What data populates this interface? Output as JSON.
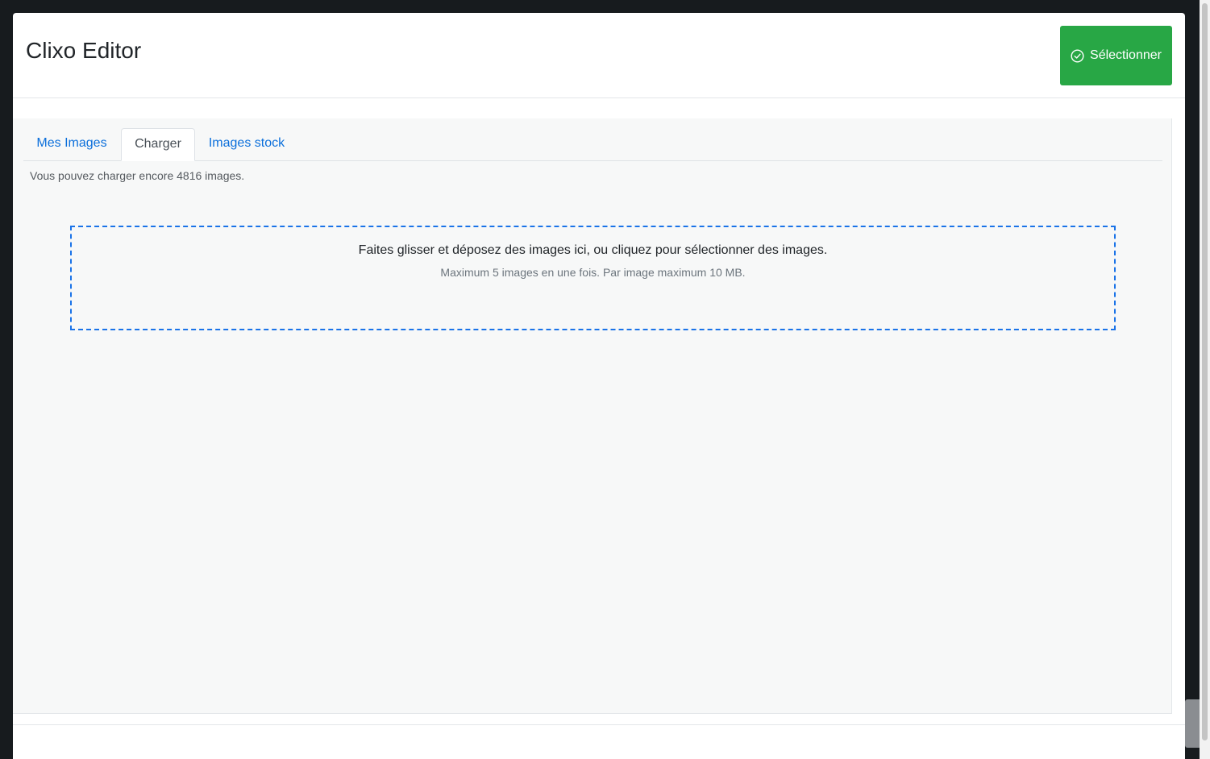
{
  "app": {
    "title": "Clixo Editor"
  },
  "header": {
    "select_button_label": "Sélectionner",
    "select_button_icon": "check-circle-icon",
    "select_button_color": "#28a745"
  },
  "tabs": [
    {
      "label": "Mes Images",
      "active": false
    },
    {
      "label": "Charger",
      "active": true
    },
    {
      "label": "Images stock",
      "active": false
    }
  ],
  "upload": {
    "quota_text": "Vous pouvez charger encore 4816 images.",
    "dropzone_main": "Faites glisser et déposez des images ici, ou cliquez pour sélectionner des images.",
    "dropzone_sub": "Maximum 5 images en une fois. Par image maximum 10 MB."
  },
  "colors": {
    "accent": "#0b6fdb",
    "dropzone_border": "#1a73e8",
    "body_background": "#f7f8f8"
  }
}
